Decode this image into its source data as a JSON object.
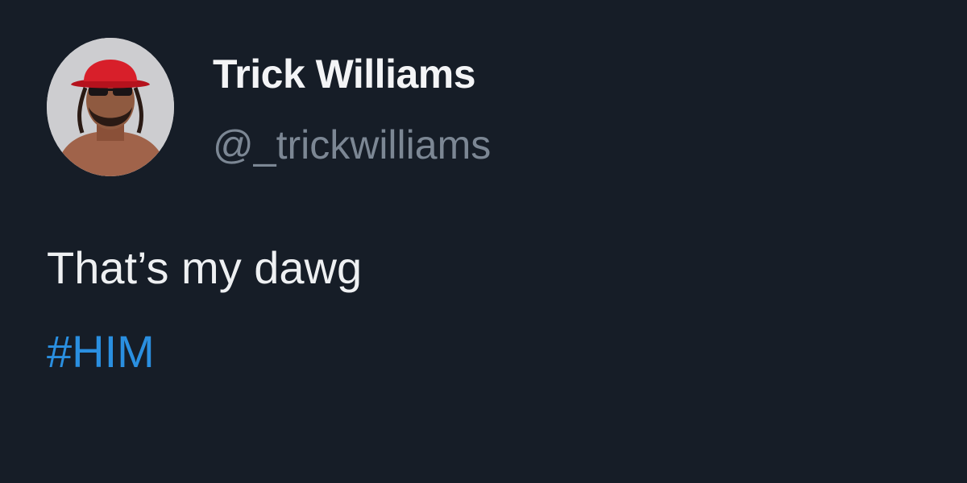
{
  "author": {
    "display_name": "Trick Williams",
    "handle": "@_trickwilliams",
    "avatar": "profile-photo"
  },
  "tweet": {
    "text": "That’s my dawg",
    "hashtag": "#HIM"
  },
  "colors": {
    "background": "#161d27",
    "name": "#f3f4f6",
    "handle": "#7c8794",
    "text": "#eef0f2",
    "hashtag": "#2a8fe0",
    "hat": "#d81f2a"
  }
}
